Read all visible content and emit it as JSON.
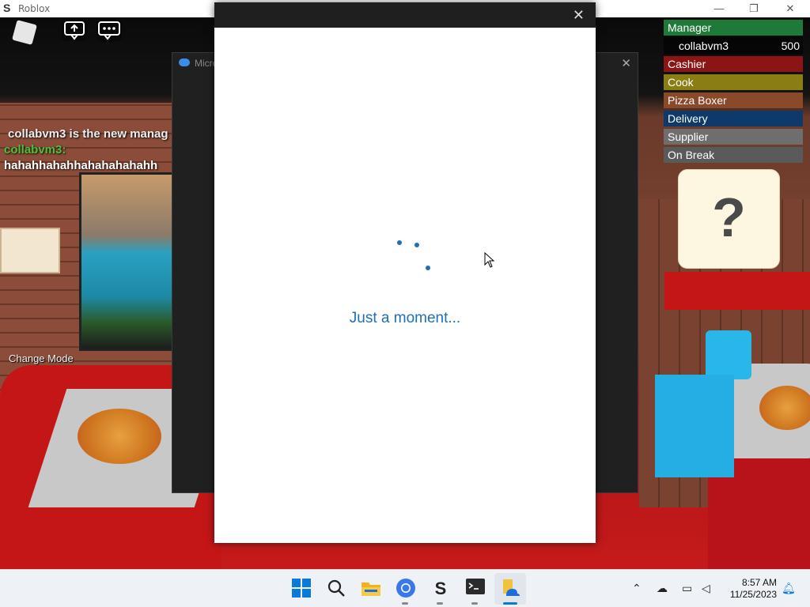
{
  "window": {
    "title": "Roblox",
    "logo_glyph": "S",
    "minimize": "—",
    "maximize": "❐",
    "close": "✕"
  },
  "chat": {
    "lines": [
      {
        "text": "collabvm3 is the new manag",
        "color": "#eeeeee"
      },
      {
        "text": "collabvm3:",
        "color": "#4fbf3a"
      },
      {
        "text": "hahahhahahhahahahahahh",
        "color": "#ffffff"
      }
    ]
  },
  "change_mode_label": "Change Mode",
  "teams": [
    {
      "name": "Manager",
      "color": "#1f7a3a"
    },
    {
      "name": "Cashier",
      "color": "#8b1414"
    },
    {
      "name": "Cook",
      "color": "#8a7d14"
    },
    {
      "name": "Pizza Boxer",
      "color": "#8a4a2a"
    },
    {
      "name": "Delivery",
      "color": "#0e3a6a"
    },
    {
      "name": "Supplier",
      "color": "#6e6e6e"
    },
    {
      "name": "On Break",
      "color": "#5a5a5a"
    }
  ],
  "manager_member": {
    "name": "collabvm3",
    "score": "500"
  },
  "speech_bubble_glyph": "?",
  "bg_dialog": {
    "title": "Micro",
    "close": "✕"
  },
  "dialog": {
    "close": "✕",
    "message": "Just a moment..."
  },
  "taskbar": {
    "time": "8:57 AM",
    "date": "11/25/2023",
    "icons": [
      "windows-start-icon",
      "search-icon",
      "file-explorer-icon",
      "chrome-icon",
      "roblox-studio-icon",
      "terminal-icon",
      "onedrive-setup-icon"
    ]
  },
  "colors": {
    "accent": "#1f6fb8",
    "taskbar": "#eef1f6"
  }
}
